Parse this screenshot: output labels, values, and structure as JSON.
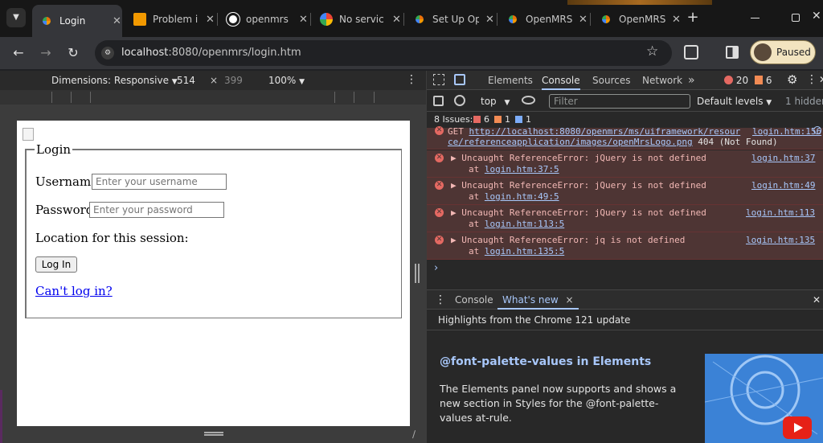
{
  "tabs": [
    {
      "label": "Login",
      "color": "#e8710a",
      "active": true
    },
    {
      "label": "Problem i",
      "color": "#f29900"
    },
    {
      "label": "openmrs",
      "color": "#ffffff"
    },
    {
      "label": "No servic",
      "color": "#4285f4"
    },
    {
      "label": "Set Up Op",
      "color": "#e8710a"
    },
    {
      "label": "OpenMRS",
      "color": "#e8710a"
    },
    {
      "label": "OpenMRS",
      "color": "#e8710a"
    }
  ],
  "address": {
    "host": "localhost",
    "rest": ":8080/openmrs/login.htm"
  },
  "profile": {
    "label": "Paused"
  },
  "device_toolbar": {
    "dimensions": "Dimensions: Responsive",
    "width": "514",
    "times": "×",
    "height": "399",
    "zoom": "100%"
  },
  "page": {
    "legend": "Login",
    "username_label": "Username:",
    "username_placeholder": "Enter your username",
    "password_label": "Password:",
    "password_placeholder": "Enter your password",
    "location_label": "Location for this session:",
    "login_button": "Log In",
    "cant_login": "Can't log in?"
  },
  "devtools": {
    "tabs": [
      "Elements",
      "Console",
      "Sources",
      "Network"
    ],
    "more": "»",
    "error_count": "20",
    "warn_count": "6",
    "context": "top",
    "filter_placeholder": "Filter",
    "levels": "Default levels",
    "hidden": "1 hidden",
    "issues": {
      "label": "8 Issues:",
      "errors": "6",
      "warnings": "1",
      "info": "1"
    },
    "messages": [
      {
        "l1a": "GET ",
        "l1link": "http://localhost:8080/openmrs/ms/uiframework/resour",
        "l1src": "login.htm:156",
        "l2link": "ce/referenceapplication/images/openMrsLogo.png",
        "l2rest": " 404 (Not Found)"
      },
      {
        "text": "▶ Uncaught ReferenceError: jQuery is not defined",
        "at": "at ",
        "atlink": "login.htm:37:5",
        "src": "login.htm:37"
      },
      {
        "text": "▶ Uncaught ReferenceError: jQuery is not defined",
        "at": "at ",
        "atlink": "login.htm:49:5",
        "src": "login.htm:49"
      },
      {
        "text": "▶ Uncaught ReferenceError: jQuery is not defined",
        "at": "at ",
        "atlink": "login.htm:113:5",
        "src": "login.htm:113"
      },
      {
        "text": "▶ Uncaught ReferenceError: jq is not defined",
        "at": "at ",
        "atlink": "login.htm:135:5",
        "src": "login.htm:135"
      }
    ],
    "prompt": "›",
    "drawer": {
      "tab1": "Console",
      "tab2": "What's new",
      "close": "×"
    },
    "whatsnew": {
      "highlight": "Highlights from the Chrome 121 update",
      "heading": "@font-palette-values in Elements",
      "body1": "The Elements panel now supports and shows a",
      "body2": "new section in Styles for the @font-palette-",
      "body3": "values at-rule."
    }
  }
}
